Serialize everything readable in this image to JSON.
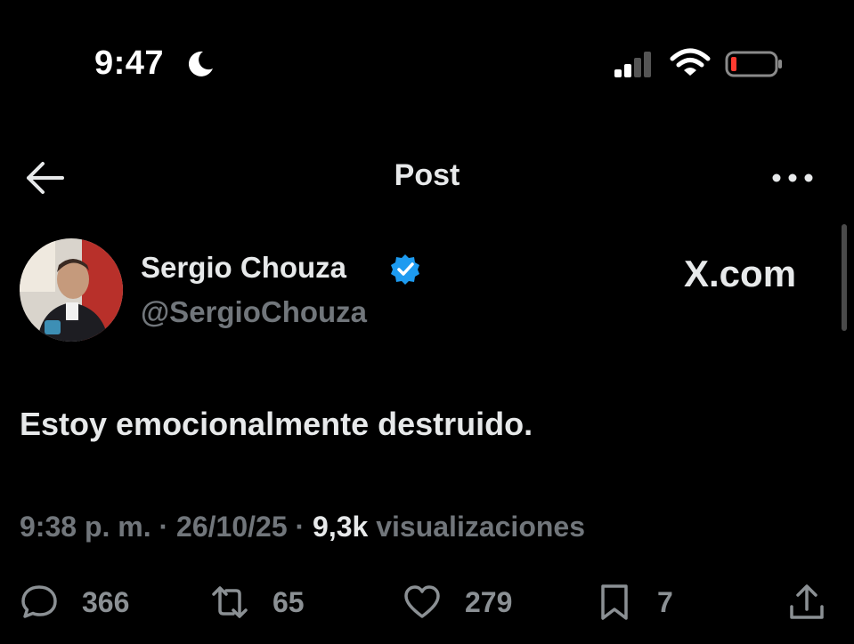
{
  "status_bar": {
    "time": "9:47"
  },
  "header": {
    "title": "Post"
  },
  "post": {
    "author_name": "Sergio Chouza",
    "author_handle": "@SergioChouza",
    "watermark": "X.com",
    "text": "Estoy emocionalmente destruido.",
    "time": "9:38 p. m.",
    "separator": "·",
    "date": "26/10/25",
    "views_count": "9,3k",
    "views_label": "visualizaciones"
  },
  "actions": {
    "replies": "366",
    "reposts": "65",
    "likes": "279",
    "bookmarks": "7"
  },
  "colors": {
    "background": "#000000",
    "text_primary": "#e7e9ea",
    "text_secondary": "#71767b",
    "verified_blue": "#1d9bf0",
    "battery_low": "#ff3b30"
  }
}
